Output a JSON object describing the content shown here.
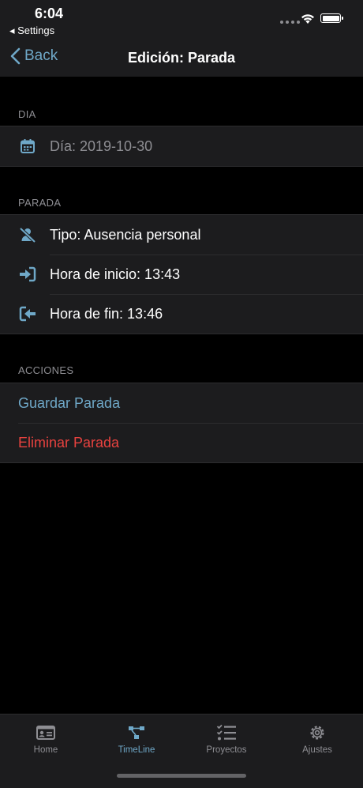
{
  "status": {
    "time": "6:04",
    "back_app": "◂ Settings"
  },
  "nav": {
    "back_label": "Back",
    "title": "Edición: Parada"
  },
  "sections": {
    "dia": {
      "header": "DIA",
      "date_row": "Día: 2019-10-30"
    },
    "parada": {
      "header": "PARADA",
      "tipo": "Tipo: Ausencia personal",
      "inicio": "Hora de inicio: 13:43",
      "fin": "Hora de fin: 13:46"
    },
    "acciones": {
      "header": "ACCIONES",
      "guardar": "Guardar Parada",
      "eliminar": "Eliminar Parada"
    }
  },
  "tabbar": {
    "tabs": [
      {
        "label": "Home",
        "icon": "id-card-icon",
        "active": false
      },
      {
        "label": "TimeLine",
        "icon": "timeline-icon",
        "active": true
      },
      {
        "label": "Proyectos",
        "icon": "checklist-icon",
        "active": false
      },
      {
        "label": "Ajustes",
        "icon": "gear-icon",
        "active": false
      }
    ]
  },
  "colors": {
    "accent": "#6fa8c8",
    "destructive": "#e8423f",
    "background": "#000000",
    "cell": "#1c1c1e"
  }
}
